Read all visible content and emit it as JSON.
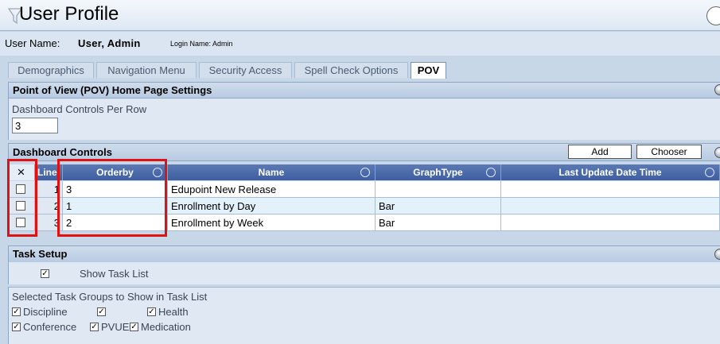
{
  "window": {
    "title": "User Profile"
  },
  "user": {
    "name_label": "User Name:",
    "name_value": "User, Admin",
    "login_text": "Login Name: Admin"
  },
  "tabs": [
    {
      "label": "Demographics"
    },
    {
      "label": "Navigation Menu"
    },
    {
      "label": "Security Access"
    },
    {
      "label": "Spell Check Options"
    },
    {
      "label": "POV",
      "active": true
    }
  ],
  "pov_section": {
    "title": "Point of View (POV) Home Page Settings",
    "per_row_label": "Dashboard Controls Per Row",
    "per_row_value": "3"
  },
  "dashboard": {
    "title": "Dashboard Controls",
    "add_label": "Add",
    "chooser_label": "Chooser",
    "columns": {
      "select": "×",
      "line": "Line",
      "orderby": "Orderby",
      "name": "Name",
      "graphtype": "GraphType",
      "lastupdate": "Last Update Date Time"
    },
    "rows": [
      {
        "line": "1",
        "orderby": "3",
        "name": "Edupoint New Release",
        "graphtype": "",
        "lastupdate": ""
      },
      {
        "line": "2",
        "orderby": "1",
        "name": "Enrollment by Day",
        "graphtype": "Bar",
        "lastupdate": ""
      },
      {
        "line": "3",
        "orderby": "2",
        "name": "Enrollment by Week",
        "graphtype": "Bar",
        "lastupdate": ""
      }
    ]
  },
  "task": {
    "title": "Task Setup",
    "show_task_list": "Show Task List",
    "groups_label": "Selected Task Groups to Show in Task List",
    "groups_row1": [
      "Discipline",
      "",
      "Health"
    ],
    "groups_row2": [
      "Conference",
      "PVUE",
      "Medication"
    ],
    "checkmark": "✓"
  },
  "colors": {
    "highlight": "#e01111",
    "header": "#3e5ea0"
  }
}
